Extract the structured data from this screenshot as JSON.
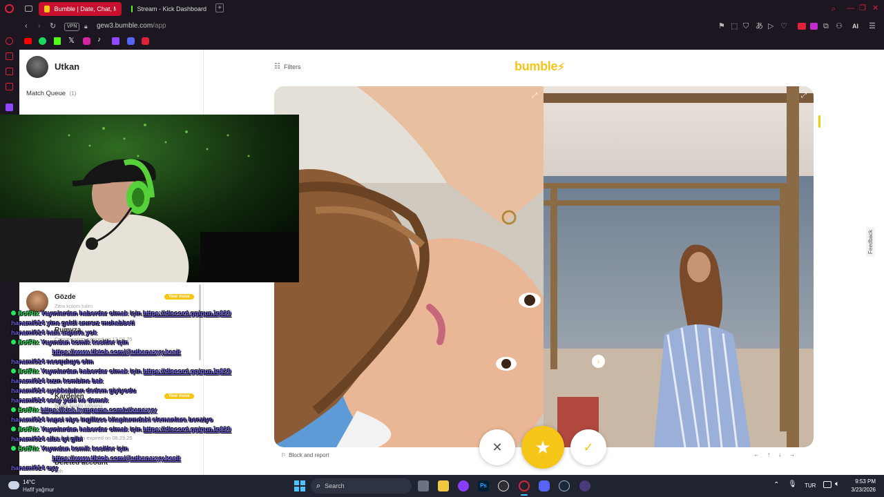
{
  "browser": {
    "tabs": [
      {
        "label": "Bumble | Date, Chat, Meet",
        "active": true,
        "favicon_color": "#f5c518"
      },
      {
        "label": "Stream - Kick Dashboard",
        "active": false,
        "favicon_color": "#53fc18"
      }
    ],
    "new_tab": "+",
    "vpn_badge": "VPN",
    "url_domain": "gew3.bumble.com",
    "url_path": "/app",
    "ai_label": "AI",
    "bookmark_icons": [
      "youtube-icon",
      "spotify-icon",
      "kick-icon",
      "x-icon",
      "instagram-icon",
      "tiktok-icon",
      "twitch-icon",
      "discord-icon",
      "app-icon"
    ]
  },
  "sidebar": {
    "user_name": "Utkan",
    "match_queue_label": "Match Queue",
    "match_queue_count": "(1)",
    "conversations": [
      {
        "name": "Gözde",
        "badge": "Your move",
        "preview": "Zitra kolom tulim"
      },
      {
        "name": "Rumyza",
        "badge": "",
        "preview": "Conversation expired on 12.03.25"
      },
      {
        "name": "Kardelen",
        "badge": "Your move",
        "preview": "Ivaals kuzim colsunu"
      },
      {
        "name": "",
        "badge": "",
        "preview": "Conversation expired on 08.29.25"
      },
      {
        "name": "Deleted account",
        "badge": "",
        "preview": "seh"
      }
    ]
  },
  "main": {
    "filters_label": "Filters",
    "logo_text": "bumble",
    "block_report_label": "Block and report",
    "keyboard_hints": [
      "←",
      "↑",
      "↓",
      "→"
    ],
    "feedback_label": "Feedback"
  },
  "chat": [
    {
      "user": "BotRix",
      "bot": true,
      "msg": "Yayınlardan haberdar olmak için",
      "link": "https://discord.gg/qunJq829"
    },
    {
      "user": "hanami014",
      "bot": false,
      "msg": "yine geldi anırsız muhabbeti",
      "link": ""
    },
    {
      "user": "hanami014",
      "bot": false,
      "msg": "hala aspava yok",
      "link": ""
    },
    {
      "user": "BotRix",
      "bot": true,
      "msg": "Yayından komik kesitler için",
      "link": ""
    },
    {
      "user": "",
      "bot": false,
      "msg": "",
      "link": "https://www.tiktok.com/@utkanaxyy.kesit"
    },
    {
      "user": "hanami014",
      "bot": false,
      "msg": "neoquluyo olm",
      "link": ""
    },
    {
      "user": "BotRix",
      "bot": true,
      "msg": "Yayınlardan haberdar olmak için",
      "link": "https://discord.gg/qunJq829"
    },
    {
      "user": "hanami014",
      "bot": false,
      "msg": "kızın kombine bak",
      "link": ""
    },
    {
      "user": "hanami014",
      "bot": false,
      "msg": "ayakkabıları dedem giyiyodu",
      "link": ""
    },
    {
      "user": "hanami014",
      "bot": false,
      "msg": "esey yani ne demek",
      "link": ""
    },
    {
      "user": "BotRix",
      "bot": true,
      "msg": "",
      "link": "https://kick.kymgame.com/utkanaxyy"
    },
    {
      "user": "hanami014",
      "bot": false,
      "msg": "hepsi niye ingilizce kitaplarındaki elemanlara benziyo",
      "link": ""
    },
    {
      "user": "BotRix",
      "bot": true,
      "msg": "Yayınlardan haberdar olmak için",
      "link": "https://discord.gg/qunJq829"
    },
    {
      "user": "hanami014",
      "bot": false,
      "msg": "alba iyi gibi",
      "link": ""
    },
    {
      "user": "BotRix",
      "bot": true,
      "msg": "Yayından komik kesitler için",
      "link": ""
    },
    {
      "user": "",
      "bot": false,
      "msg": "",
      "link": "https://www.tiktok.com/@utkanaxyy.kesit"
    },
    {
      "user": "hanami014",
      "bot": false,
      "msg": "oyy",
      "link": ""
    }
  ],
  "taskbar": {
    "weather_temp": "14°C",
    "weather_desc": "Hafif yağmur",
    "search_placeholder": "Search",
    "lang": "TUR",
    "time": "9:53 PM",
    "date": "3/23/2026"
  }
}
